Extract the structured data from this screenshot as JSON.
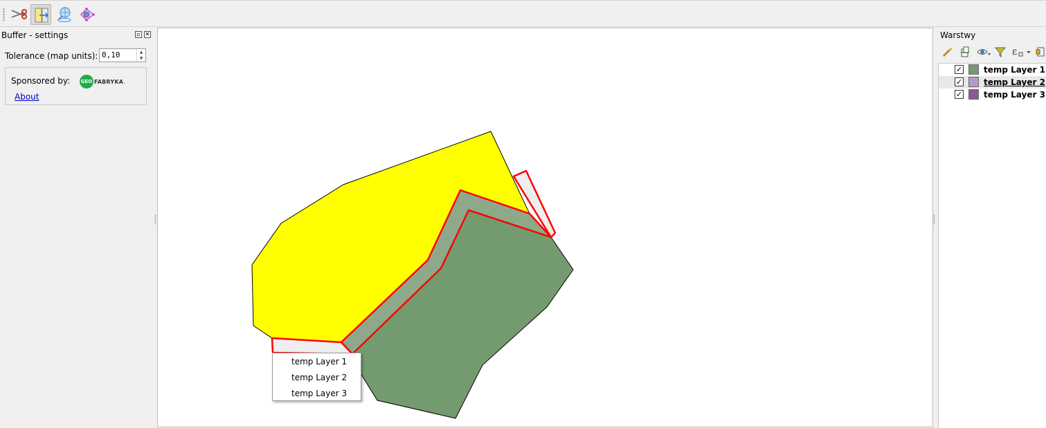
{
  "toolbar": {
    "buttons": [
      {
        "icon": "scissors-icon",
        "active": false
      },
      {
        "icon": "buffer-split-icon",
        "active": true
      },
      {
        "icon": "globe-select-icon",
        "active": false
      },
      {
        "icon": "node-vertex-icon",
        "active": false
      }
    ]
  },
  "left_dock": {
    "title": "Buffer - settings",
    "tolerance_label": "Tolerance (map units):",
    "tolerance_value": "0,10",
    "sponsored_label": "Sponsored by:",
    "logo_geo": "GEO",
    "logo_text": "FABRYKA",
    "about_link": "About"
  },
  "context_menu": {
    "items": [
      "temp Layer 1",
      "temp Layer 2",
      "temp Layer 3"
    ]
  },
  "layers_panel": {
    "title": "Warstwy",
    "layers": [
      {
        "name": "temp Layer 1",
        "checked": true,
        "color": "#739b6f",
        "selected": false
      },
      {
        "name": "temp Layer 2",
        "checked": true,
        "color": "#b39cc4",
        "selected": true
      },
      {
        "name": "temp Layer 3",
        "checked": true,
        "color": "#8a5a96",
        "selected": false
      }
    ],
    "check_mark": "✓"
  },
  "colors": {
    "yellow_fill": "#ffff00",
    "green_fill": "#739b6f",
    "buffer_outline": "#ff0000",
    "buffer_fill": "#eeeeee"
  }
}
